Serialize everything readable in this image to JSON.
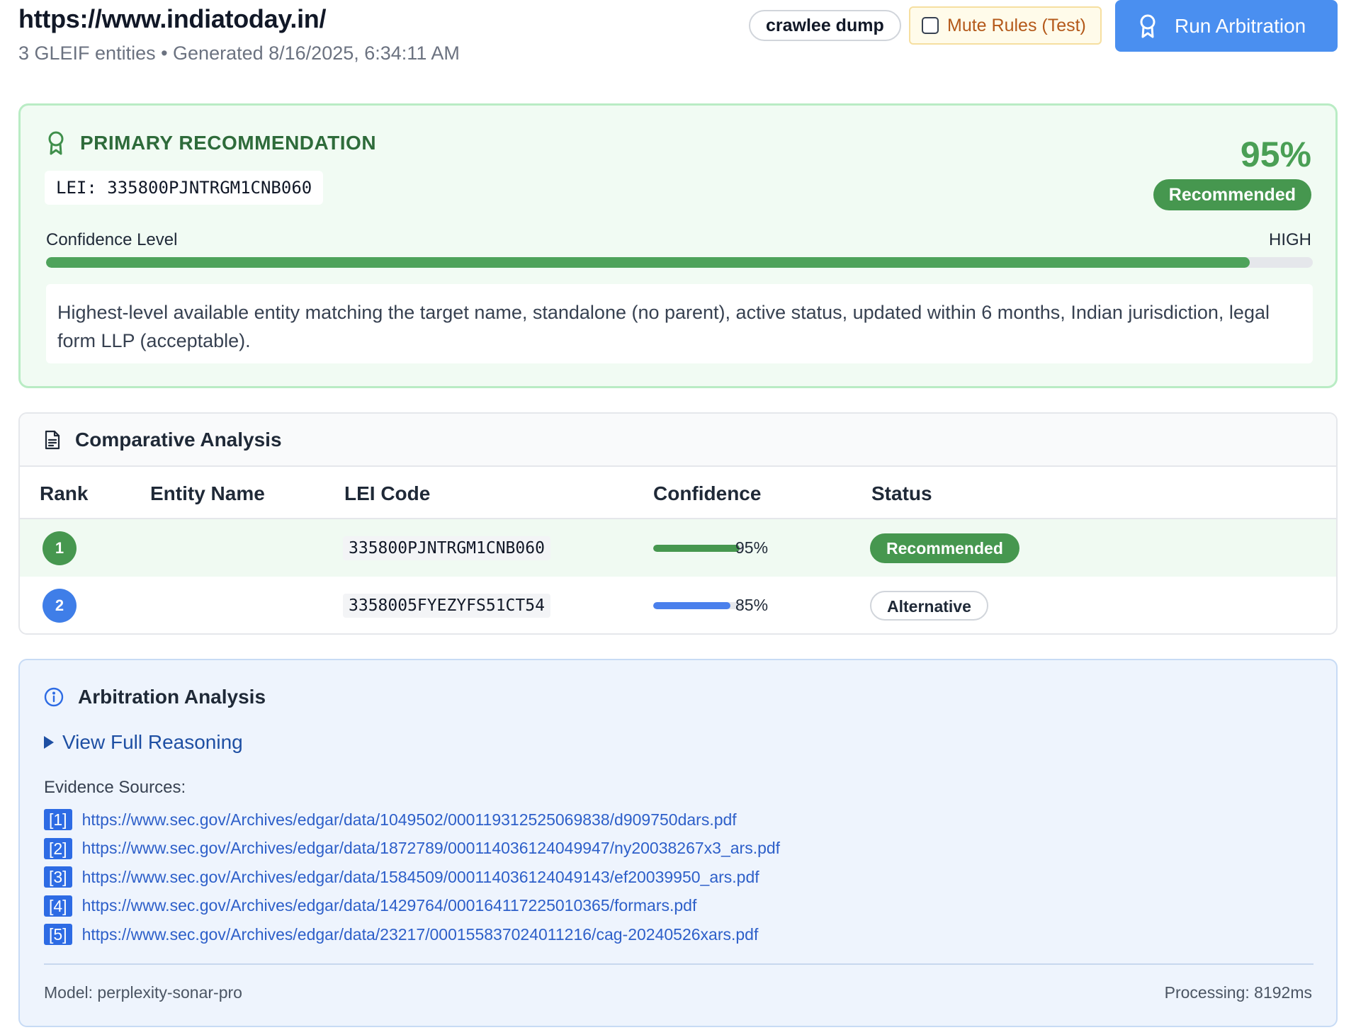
{
  "header": {
    "title": "https://www.indiatoday.in/",
    "subtitle": "3 GLEIF entities • Generated 8/16/2025, 6:34:11 AM",
    "source_chip": "crawlee dump",
    "mute_label": "Mute Rules (Test)",
    "mute_checked": false,
    "run_label": "Run Arbitration"
  },
  "primary": {
    "heading": "PRIMARY RECOMMENDATION",
    "lei": "LEI: 335800PJNTRGM1CNB060",
    "percent": "95%",
    "badge": "Recommended",
    "confidence_label": "Confidence Level",
    "confidence_level": "HIGH",
    "confidence_fraction": 0.95,
    "reasoning": "Highest-level available entity matching the target name, standalone (no parent), active status, updated within 6 months, Indian jurisdiction, legal form LLP (acceptable)."
  },
  "comparative": {
    "title": "Comparative Analysis",
    "columns": [
      "Rank",
      "Entity Name",
      "LEI Code",
      "Confidence",
      "Status"
    ],
    "rows": [
      {
        "rank": "1",
        "entity": "",
        "lei": "335800PJNTRGM1CNB060",
        "confidence": "95%",
        "confidence_fraction": 0.95,
        "status": "Recommended"
      },
      {
        "rank": "2",
        "entity": "",
        "lei": "3358005FYEZYFS51CT54",
        "confidence": "85%",
        "confidence_fraction": 0.85,
        "status": "Alternative"
      }
    ]
  },
  "arbitration": {
    "title": "Arbitration Analysis",
    "view_reasoning": "View Full Reasoning",
    "evidence_label": "Evidence Sources:",
    "sources": [
      {
        "num": "[1]",
        "url": "https://www.sec.gov/Archives/edgar/data/1049502/000119312525069838/d909750dars.pdf"
      },
      {
        "num": "[2]",
        "url": "https://www.sec.gov/Archives/edgar/data/1872789/000114036124049947/ny20038267x3_ars.pdf"
      },
      {
        "num": "[3]",
        "url": "https://www.sec.gov/Archives/edgar/data/1584509/000114036124049143/ef20039950_ars.pdf"
      },
      {
        "num": "[4]",
        "url": "https://www.sec.gov/Archives/edgar/data/1429764/000164117225010365/formars.pdf"
      },
      {
        "num": "[5]",
        "url": "https://www.sec.gov/Archives/edgar/data/23217/000155837024011216/cag-20240526xars.pdf"
      }
    ],
    "model": "Model: perplexity-sonar-pro",
    "processing": "Processing: 8192ms"
  },
  "colors": {
    "primary_green": "#46974f",
    "accent_blue": "#4a8ff0",
    "rank2_blue": "#3f7ee8"
  }
}
